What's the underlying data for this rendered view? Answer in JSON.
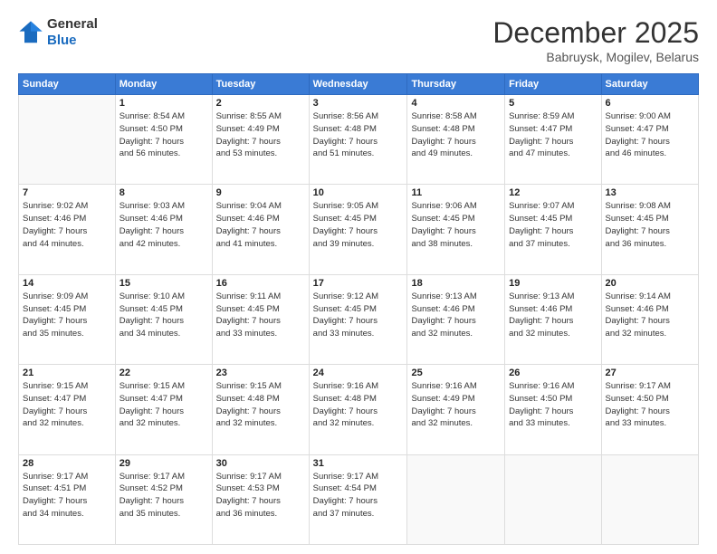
{
  "header": {
    "logo_line1": "General",
    "logo_line2": "Blue",
    "month": "December 2025",
    "location": "Babruysk, Mogilev, Belarus"
  },
  "weekdays": [
    "Sunday",
    "Monday",
    "Tuesday",
    "Wednesday",
    "Thursday",
    "Friday",
    "Saturday"
  ],
  "weeks": [
    [
      {
        "day": "",
        "detail": ""
      },
      {
        "day": "1",
        "detail": "Sunrise: 8:54 AM\nSunset: 4:50 PM\nDaylight: 7 hours\nand 56 minutes."
      },
      {
        "day": "2",
        "detail": "Sunrise: 8:55 AM\nSunset: 4:49 PM\nDaylight: 7 hours\nand 53 minutes."
      },
      {
        "day": "3",
        "detail": "Sunrise: 8:56 AM\nSunset: 4:48 PM\nDaylight: 7 hours\nand 51 minutes."
      },
      {
        "day": "4",
        "detail": "Sunrise: 8:58 AM\nSunset: 4:48 PM\nDaylight: 7 hours\nand 49 minutes."
      },
      {
        "day": "5",
        "detail": "Sunrise: 8:59 AM\nSunset: 4:47 PM\nDaylight: 7 hours\nand 47 minutes."
      },
      {
        "day": "6",
        "detail": "Sunrise: 9:00 AM\nSunset: 4:47 PM\nDaylight: 7 hours\nand 46 minutes."
      }
    ],
    [
      {
        "day": "7",
        "detail": "Sunrise: 9:02 AM\nSunset: 4:46 PM\nDaylight: 7 hours\nand 44 minutes."
      },
      {
        "day": "8",
        "detail": "Sunrise: 9:03 AM\nSunset: 4:46 PM\nDaylight: 7 hours\nand 42 minutes."
      },
      {
        "day": "9",
        "detail": "Sunrise: 9:04 AM\nSunset: 4:46 PM\nDaylight: 7 hours\nand 41 minutes."
      },
      {
        "day": "10",
        "detail": "Sunrise: 9:05 AM\nSunset: 4:45 PM\nDaylight: 7 hours\nand 39 minutes."
      },
      {
        "day": "11",
        "detail": "Sunrise: 9:06 AM\nSunset: 4:45 PM\nDaylight: 7 hours\nand 38 minutes."
      },
      {
        "day": "12",
        "detail": "Sunrise: 9:07 AM\nSunset: 4:45 PM\nDaylight: 7 hours\nand 37 minutes."
      },
      {
        "day": "13",
        "detail": "Sunrise: 9:08 AM\nSunset: 4:45 PM\nDaylight: 7 hours\nand 36 minutes."
      }
    ],
    [
      {
        "day": "14",
        "detail": "Sunrise: 9:09 AM\nSunset: 4:45 PM\nDaylight: 7 hours\nand 35 minutes."
      },
      {
        "day": "15",
        "detail": "Sunrise: 9:10 AM\nSunset: 4:45 PM\nDaylight: 7 hours\nand 34 minutes."
      },
      {
        "day": "16",
        "detail": "Sunrise: 9:11 AM\nSunset: 4:45 PM\nDaylight: 7 hours\nand 33 minutes."
      },
      {
        "day": "17",
        "detail": "Sunrise: 9:12 AM\nSunset: 4:45 PM\nDaylight: 7 hours\nand 33 minutes."
      },
      {
        "day": "18",
        "detail": "Sunrise: 9:13 AM\nSunset: 4:46 PM\nDaylight: 7 hours\nand 32 minutes."
      },
      {
        "day": "19",
        "detail": "Sunrise: 9:13 AM\nSunset: 4:46 PM\nDaylight: 7 hours\nand 32 minutes."
      },
      {
        "day": "20",
        "detail": "Sunrise: 9:14 AM\nSunset: 4:46 PM\nDaylight: 7 hours\nand 32 minutes."
      }
    ],
    [
      {
        "day": "21",
        "detail": "Sunrise: 9:15 AM\nSunset: 4:47 PM\nDaylight: 7 hours\nand 32 minutes."
      },
      {
        "day": "22",
        "detail": "Sunrise: 9:15 AM\nSunset: 4:47 PM\nDaylight: 7 hours\nand 32 minutes."
      },
      {
        "day": "23",
        "detail": "Sunrise: 9:15 AM\nSunset: 4:48 PM\nDaylight: 7 hours\nand 32 minutes."
      },
      {
        "day": "24",
        "detail": "Sunrise: 9:16 AM\nSunset: 4:48 PM\nDaylight: 7 hours\nand 32 minutes."
      },
      {
        "day": "25",
        "detail": "Sunrise: 9:16 AM\nSunset: 4:49 PM\nDaylight: 7 hours\nand 32 minutes."
      },
      {
        "day": "26",
        "detail": "Sunrise: 9:16 AM\nSunset: 4:50 PM\nDaylight: 7 hours\nand 33 minutes."
      },
      {
        "day": "27",
        "detail": "Sunrise: 9:17 AM\nSunset: 4:50 PM\nDaylight: 7 hours\nand 33 minutes."
      }
    ],
    [
      {
        "day": "28",
        "detail": "Sunrise: 9:17 AM\nSunset: 4:51 PM\nDaylight: 7 hours\nand 34 minutes."
      },
      {
        "day": "29",
        "detail": "Sunrise: 9:17 AM\nSunset: 4:52 PM\nDaylight: 7 hours\nand 35 minutes."
      },
      {
        "day": "30",
        "detail": "Sunrise: 9:17 AM\nSunset: 4:53 PM\nDaylight: 7 hours\nand 36 minutes."
      },
      {
        "day": "31",
        "detail": "Sunrise: 9:17 AM\nSunset: 4:54 PM\nDaylight: 7 hours\nand 37 minutes."
      },
      {
        "day": "",
        "detail": ""
      },
      {
        "day": "",
        "detail": ""
      },
      {
        "day": "",
        "detail": ""
      }
    ]
  ]
}
